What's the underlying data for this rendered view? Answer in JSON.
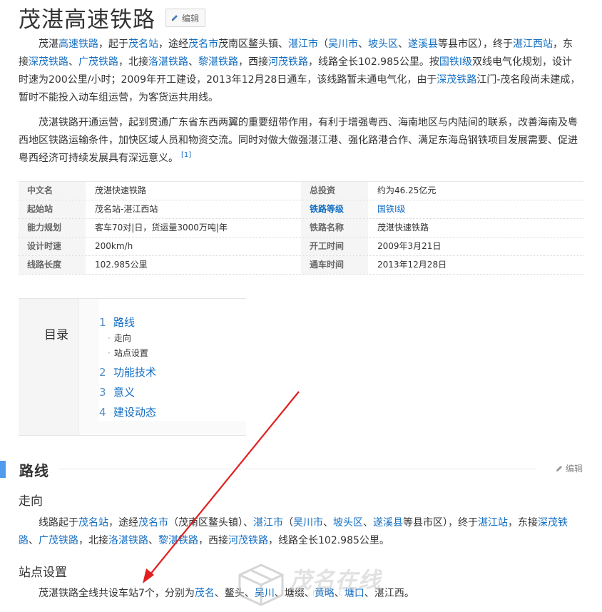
{
  "title": "茂湛高速铁路",
  "edit_label": "编辑",
  "intro1": [
    {
      "t": "茂湛",
      "link": false
    },
    {
      "t": "高速铁路",
      "link": true
    },
    {
      "t": "，起于",
      "link": false
    },
    {
      "t": "茂名站",
      "link": true
    },
    {
      "t": "，途经",
      "link": false
    },
    {
      "t": "茂名市",
      "link": true
    },
    {
      "t": "茂南区鳌头镇、",
      "link": false
    },
    {
      "t": "湛江市",
      "link": true
    },
    {
      "t": "（",
      "link": false
    },
    {
      "t": "吴川市",
      "link": true
    },
    {
      "t": "、",
      "link": false
    },
    {
      "t": "坡头区",
      "link": true
    },
    {
      "t": "、",
      "link": false
    },
    {
      "t": "遂溪县",
      "link": true
    },
    {
      "t": "等县市区），终于",
      "link": false
    },
    {
      "t": "湛江西站",
      "link": true
    },
    {
      "t": "，东接",
      "link": false
    },
    {
      "t": "深茂铁路",
      "link": true
    },
    {
      "t": "、",
      "link": false
    },
    {
      "t": "广茂铁路",
      "link": true
    },
    {
      "t": "，北接",
      "link": false
    },
    {
      "t": "洛湛铁路",
      "link": true
    },
    {
      "t": "、",
      "link": false
    },
    {
      "t": "黎湛铁路",
      "link": true
    },
    {
      "t": "，西接",
      "link": false
    },
    {
      "t": "河茂铁路",
      "link": true
    },
    {
      "t": "，线路全长102.985公里。按",
      "link": false
    },
    {
      "t": "国铁Ⅰ级",
      "link": true
    },
    {
      "t": "双线电气化规划，设计时速为200公里/小时；2009年开工建设，2013年12月28日通车，该线路暂未通电气化，由于",
      "link": false
    },
    {
      "t": "深茂铁路",
      "link": true
    },
    {
      "t": "江门-茂名段尚未建成，暂时不能投入动车组运营，为客货运共用线。",
      "link": false
    }
  ],
  "intro2": "茂湛铁路开通运营，起到贯通广东省东西两翼的重要纽带作用，有利于增强粤西、海南地区与内陆间的联系，改善海南及粤西地区铁路运输条件，加快区域人员和物资交流。同时对做大做强湛江港、强化路港合作、满足东海岛钢铁项目发展需要、促进粤西经济可持续发展具有深远意义。",
  "intro2_ref": "[1]",
  "infobox": [
    [
      {
        "label": "中文名",
        "value": "茂湛快速铁路"
      },
      {
        "label": "总投资",
        "value": "约为46.25亿元"
      }
    ],
    [
      {
        "label": "起始站",
        "value": "茂名站-湛江西站"
      },
      {
        "label": "铁路等级",
        "value": "国铁Ⅰ级",
        "link": true
      }
    ],
    [
      {
        "label": "能力规划",
        "value": "客车70对|日，货运量3000万吨|年"
      },
      {
        "label": "铁路名称",
        "value": "茂湛快速铁路"
      }
    ],
    [
      {
        "label": "设计时速",
        "value": "200km/h"
      },
      {
        "label": "开工时间",
        "value": "2009年3月21日"
      }
    ],
    [
      {
        "label": "线路长度",
        "value": "102.985公里"
      },
      {
        "label": "通车时间",
        "value": "2013年12月28日"
      }
    ]
  ],
  "toc": {
    "title": "目录",
    "items": [
      {
        "num": "1",
        "label": "路线"
      },
      {
        "num": "2",
        "label": "功能技术"
      },
      {
        "num": "3",
        "label": "意义"
      },
      {
        "num": "4",
        "label": "建设动态"
      }
    ],
    "subs": [
      {
        "dot": "·",
        "label": "走向"
      },
      {
        "dot": "·",
        "label": "站点设置"
      }
    ]
  },
  "section": {
    "title": "路线",
    "edit_label": "编辑"
  },
  "sub1": {
    "title": "走向"
  },
  "route": [
    {
      "t": "线路起于",
      "link": false
    },
    {
      "t": "茂名站",
      "link": true
    },
    {
      "t": "，途经",
      "link": false
    },
    {
      "t": "茂名市",
      "link": true
    },
    {
      "t": "（茂南区鳌头镇）、",
      "link": false
    },
    {
      "t": "湛江市",
      "link": true
    },
    {
      "t": "（",
      "link": false
    },
    {
      "t": "吴川市",
      "link": true
    },
    {
      "t": "、",
      "link": false
    },
    {
      "t": "坡头区",
      "link": true
    },
    {
      "t": "、",
      "link": false
    },
    {
      "t": "遂溪县",
      "link": true
    },
    {
      "t": "等县市区），终于",
      "link": false
    },
    {
      "t": "湛江站",
      "link": true
    },
    {
      "t": "，东接",
      "link": false
    },
    {
      "t": "深茂铁路",
      "link": true
    },
    {
      "t": "、",
      "link": false
    },
    {
      "t": "广茂铁路",
      "link": true
    },
    {
      "t": "，北接",
      "link": false
    },
    {
      "t": "洛湛铁路",
      "link": true
    },
    {
      "t": "、",
      "link": false
    },
    {
      "t": "黎湛铁路",
      "link": true
    },
    {
      "t": "，西接",
      "link": false
    },
    {
      "t": "河茂铁路",
      "link": true
    },
    {
      "t": "，线路全长102.985公里。",
      "link": false
    }
  ],
  "sub2": {
    "title": "站点设置"
  },
  "stations": [
    {
      "t": "茂湛铁路全线共设车站7个，分别为",
      "link": false
    },
    {
      "t": "茂名",
      "link": true
    },
    {
      "t": "、鳌头、",
      "link": false
    },
    {
      "t": "吴川",
      "link": true
    },
    {
      "t": "、塘缀、",
      "link": false
    },
    {
      "t": "黄略",
      "link": true
    },
    {
      "t": "、",
      "link": false
    },
    {
      "t": "塘口",
      "link": true
    },
    {
      "t": "、湛江西。",
      "link": false
    }
  ],
  "watermark": {
    "text": "茂名在线",
    "url": "cc.mm.com"
  },
  "colors": {
    "link": "#136ec2",
    "accent": "#4f9cee",
    "arrow": "#e02020"
  }
}
